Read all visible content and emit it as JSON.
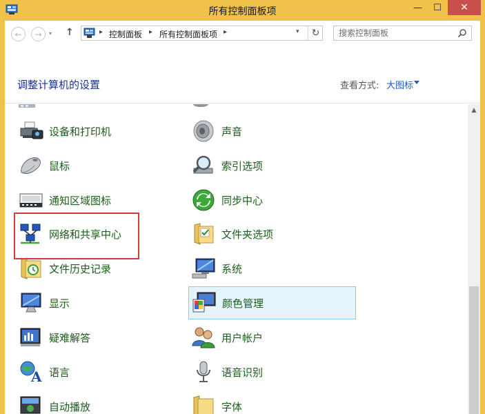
{
  "window": {
    "title": "所有控制面板项",
    "minimize_glyph": "—",
    "maximize_glyph": "☐",
    "close_glyph": "✕"
  },
  "nav": {
    "back_icon": "arrow-left-icon",
    "forward_icon": "arrow-right-icon",
    "recent_icon": "chevron-down-icon",
    "up_icon": "arrow-up-icon",
    "back_glyph": "←",
    "forward_glyph": "→",
    "recent_glyph": "▾",
    "up_glyph": "↑",
    "breadcrumb": [
      "控制面板",
      "所有控制面板项"
    ],
    "separator": "▸",
    "dropdown_glyph": "▾",
    "refresh_glyph": "↻",
    "search_placeholder": "搜索控制面板"
  },
  "header": {
    "title": "调整计算机的设置",
    "view_label": "查看方式:",
    "view_value": "大图标"
  },
  "items": [
    {
      "label": "设备和打印机",
      "icon": "printer-icon"
    },
    {
      "label": "声音",
      "icon": "speaker-icon"
    },
    {
      "label": "鼠标",
      "icon": "mouse-icon"
    },
    {
      "label": "索引选项",
      "icon": "magnifier-icon"
    },
    {
      "label": "通知区域图标",
      "icon": "notification-tray-icon"
    },
    {
      "label": "同步中心",
      "icon": "sync-icon"
    },
    {
      "label": "网络和共享中心",
      "icon": "network-icon"
    },
    {
      "label": "文件夹选项",
      "icon": "folder-options-icon"
    },
    {
      "label": "文件历史记录",
      "icon": "file-history-icon"
    },
    {
      "label": "系统",
      "icon": "system-icon"
    },
    {
      "label": "显示",
      "icon": "display-icon"
    },
    {
      "label": "颜色管理",
      "icon": "color-management-icon",
      "selected": true
    },
    {
      "label": "疑难解答",
      "icon": "troubleshoot-icon"
    },
    {
      "label": "用户帐户",
      "icon": "user-accounts-icon"
    },
    {
      "label": "语言",
      "icon": "language-icon"
    },
    {
      "label": "语音识别",
      "icon": "microphone-icon"
    },
    {
      "label": "自动播放",
      "icon": "autoplay-icon"
    },
    {
      "label": "字体",
      "icon": "fonts-folder-icon"
    }
  ],
  "colors": {
    "title_bar": "#f0c24a",
    "close_button": "#c7504a",
    "item_text": "#1a5e1a",
    "header_text": "#1e3287",
    "link": "#1e5bc6",
    "selection_fill": "#e5f3fb",
    "selection_border": "#8fcbe6",
    "highlight_box": "#d9363e"
  }
}
